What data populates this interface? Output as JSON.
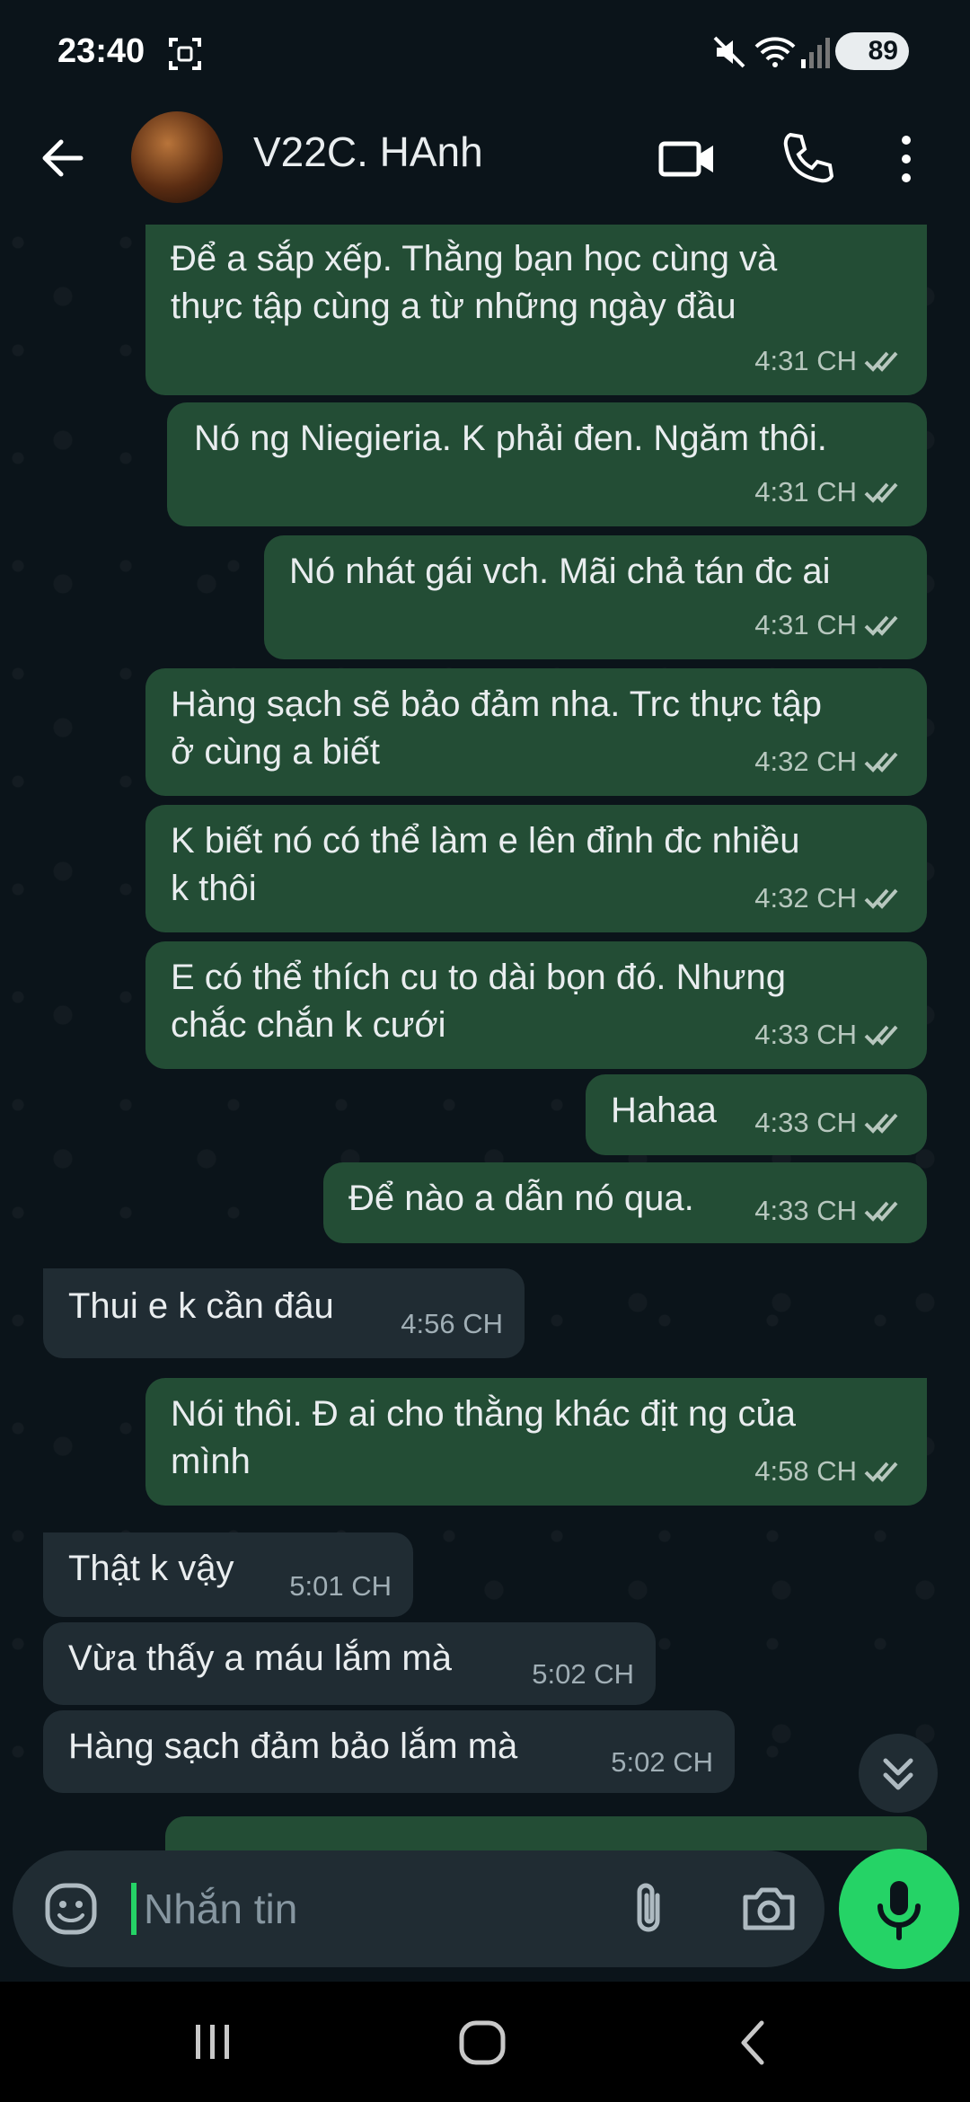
{
  "status_bar": {
    "time": "23:40",
    "battery": "89",
    "icons": [
      "screenshot-icon",
      "mute-icon",
      "wifi-icon",
      "signal-icon",
      "battery-icon"
    ]
  },
  "app_bar": {
    "title": "V22C. HAnh",
    "icons": [
      "back-arrow-icon",
      "video-call-icon",
      "phone-icon",
      "more-vert-icon"
    ]
  },
  "messages": [
    {
      "dir": "out",
      "lines": [
        "Để a sắp xếp. Thằng bạn học cùng và",
        "thực tập cùng a từ những ngày đầu"
      ],
      "time": "4:31 CH"
    },
    {
      "dir": "out",
      "lines": [
        "Nó ng Niegieria. K phải đen. Ngăm thôi."
      ],
      "time": "4:31 CH"
    },
    {
      "dir": "out",
      "lines": [
        "Nó nhát gái vch. Mãi chả tán đc ai"
      ],
      "time": "4:31 CH"
    },
    {
      "dir": "out",
      "lines": [
        "Hàng sạch sẽ bảo đảm nha. Trc thực tập",
        "ở cùng a biết"
      ],
      "time": "4:32 CH"
    },
    {
      "dir": "out",
      "lines": [
        "K biết nó có thể làm e lên đỉnh đc nhiều",
        "k thôi"
      ],
      "time": "4:32 CH"
    },
    {
      "dir": "out",
      "lines": [
        "E có thể thích cu to dài bọn đó. Nhưng",
        "chắc chắn k cưới"
      ],
      "time": "4:33 CH"
    },
    {
      "dir": "out",
      "lines": [
        "Hahaa"
      ],
      "time": "4:33 CH"
    },
    {
      "dir": "out",
      "lines": [
        "Để nào a dẫn nó qua."
      ],
      "time": "4:33 CH"
    },
    {
      "dir": "in",
      "lines": [
        "Thui e k cần đâu"
      ],
      "time": "4:56 CH"
    },
    {
      "dir": "out",
      "lines": [
        "Nói thôi. Đ ai cho thằng khác địt ng của",
        "mình"
      ],
      "time": "4:58 CH"
    },
    {
      "dir": "in",
      "lines": [
        "Thật k vậy"
      ],
      "time": "5:01 CH"
    },
    {
      "dir": "in",
      "lines": [
        "Vừa thấy a máu lắm mà"
      ],
      "time": "5:02 CH"
    },
    {
      "dir": "in",
      "lines": [
        "Hàng sạch đảm bảo lắm mà"
      ],
      "time": "5:02 CH"
    }
  ],
  "composer": {
    "placeholder": "Nhắn tin",
    "icons": [
      "emoji-icon",
      "attach-icon",
      "camera-icon",
      "mic-icon"
    ]
  },
  "colors": {
    "background": "#0b141a",
    "outgoing_bubble": "#234d35",
    "incoming_bubble": "#202c33",
    "accent": "#25d366",
    "read_ticks": "#b7c7be"
  },
  "nav_bar": {
    "icons": [
      "recents-icon",
      "home-icon",
      "back-icon"
    ]
  }
}
